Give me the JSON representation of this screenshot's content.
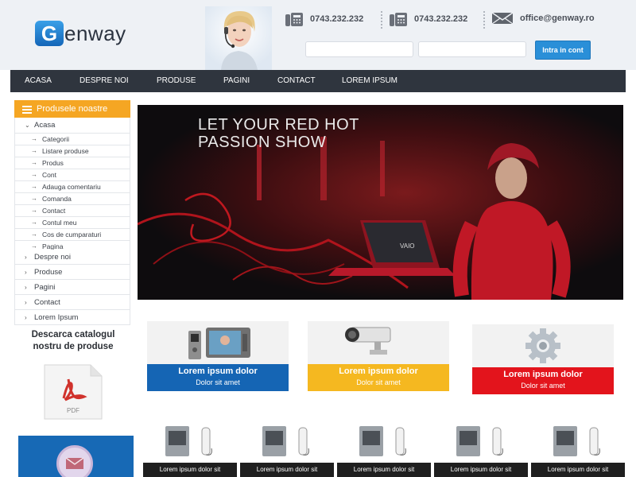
{
  "header": {
    "logo_initial": "G",
    "logo_rest": "enway",
    "phone_1": "0743.232.232",
    "phone_2": "0743.232.232",
    "email": "office@genway.ro",
    "login_label": "Intra in cont",
    "user_value": "",
    "pass_value": ""
  },
  "nav": {
    "items": [
      "ACASA",
      "DESPRE NOI",
      "PRODUSE",
      "PAGINI",
      "CONTACT",
      "LOREM IPSUM"
    ]
  },
  "sidebar": {
    "title": "Produsele noastre",
    "menu": [
      {
        "label": "Acasa"
      },
      {
        "label": "Categorii"
      },
      {
        "label": "Listare produse"
      },
      {
        "label": "Produs"
      },
      {
        "label": "Cont"
      },
      {
        "label": "Adauga comentariu"
      },
      {
        "label": "Comanda"
      },
      {
        "label": "Contact"
      },
      {
        "label": "Contul meu"
      },
      {
        "label": "Cos de cumparaturi"
      },
      {
        "label": "Pagina"
      },
      {
        "label": "Despre noi"
      },
      {
        "label": "Produse"
      },
      {
        "label": "Pagini"
      },
      {
        "label": "Contact"
      },
      {
        "label": "Lorem Ipsum"
      }
    ],
    "catalog_line1": "Descarca catalogul",
    "catalog_line2": "nostru de produse",
    "pdf_label": "PDF"
  },
  "banner": {
    "line1": "LET YOUR RED HOT",
    "line2": "PASSION SHOW",
    "laptop_brand": "VAIO"
  },
  "features": [
    {
      "title": "Lorem ipsum dolor",
      "subtitle": "Dolor sit amet",
      "color": "#1565b4"
    },
    {
      "title": "Lorem ipsum dolor",
      "subtitle": "Dolor sit amet",
      "color": "#f5b820"
    },
    {
      "title": "Lorem ipsum dolor",
      "subtitle": "Dolor sit amet",
      "color": "#e3141c"
    }
  ],
  "products": [
    {
      "label": "Lorem ipsum dolor sit"
    },
    {
      "label": "Lorem ipsum dolor sit"
    },
    {
      "label": "Lorem ipsum dolor sit"
    },
    {
      "label": "Lorem ipsum dolor sit"
    },
    {
      "label": "Lorem ipsum dolor sit"
    }
  ],
  "colors": {
    "nav_bg": "#2f353e",
    "accent_orange": "#f5a623",
    "login_blue": "#2a8fd8"
  }
}
